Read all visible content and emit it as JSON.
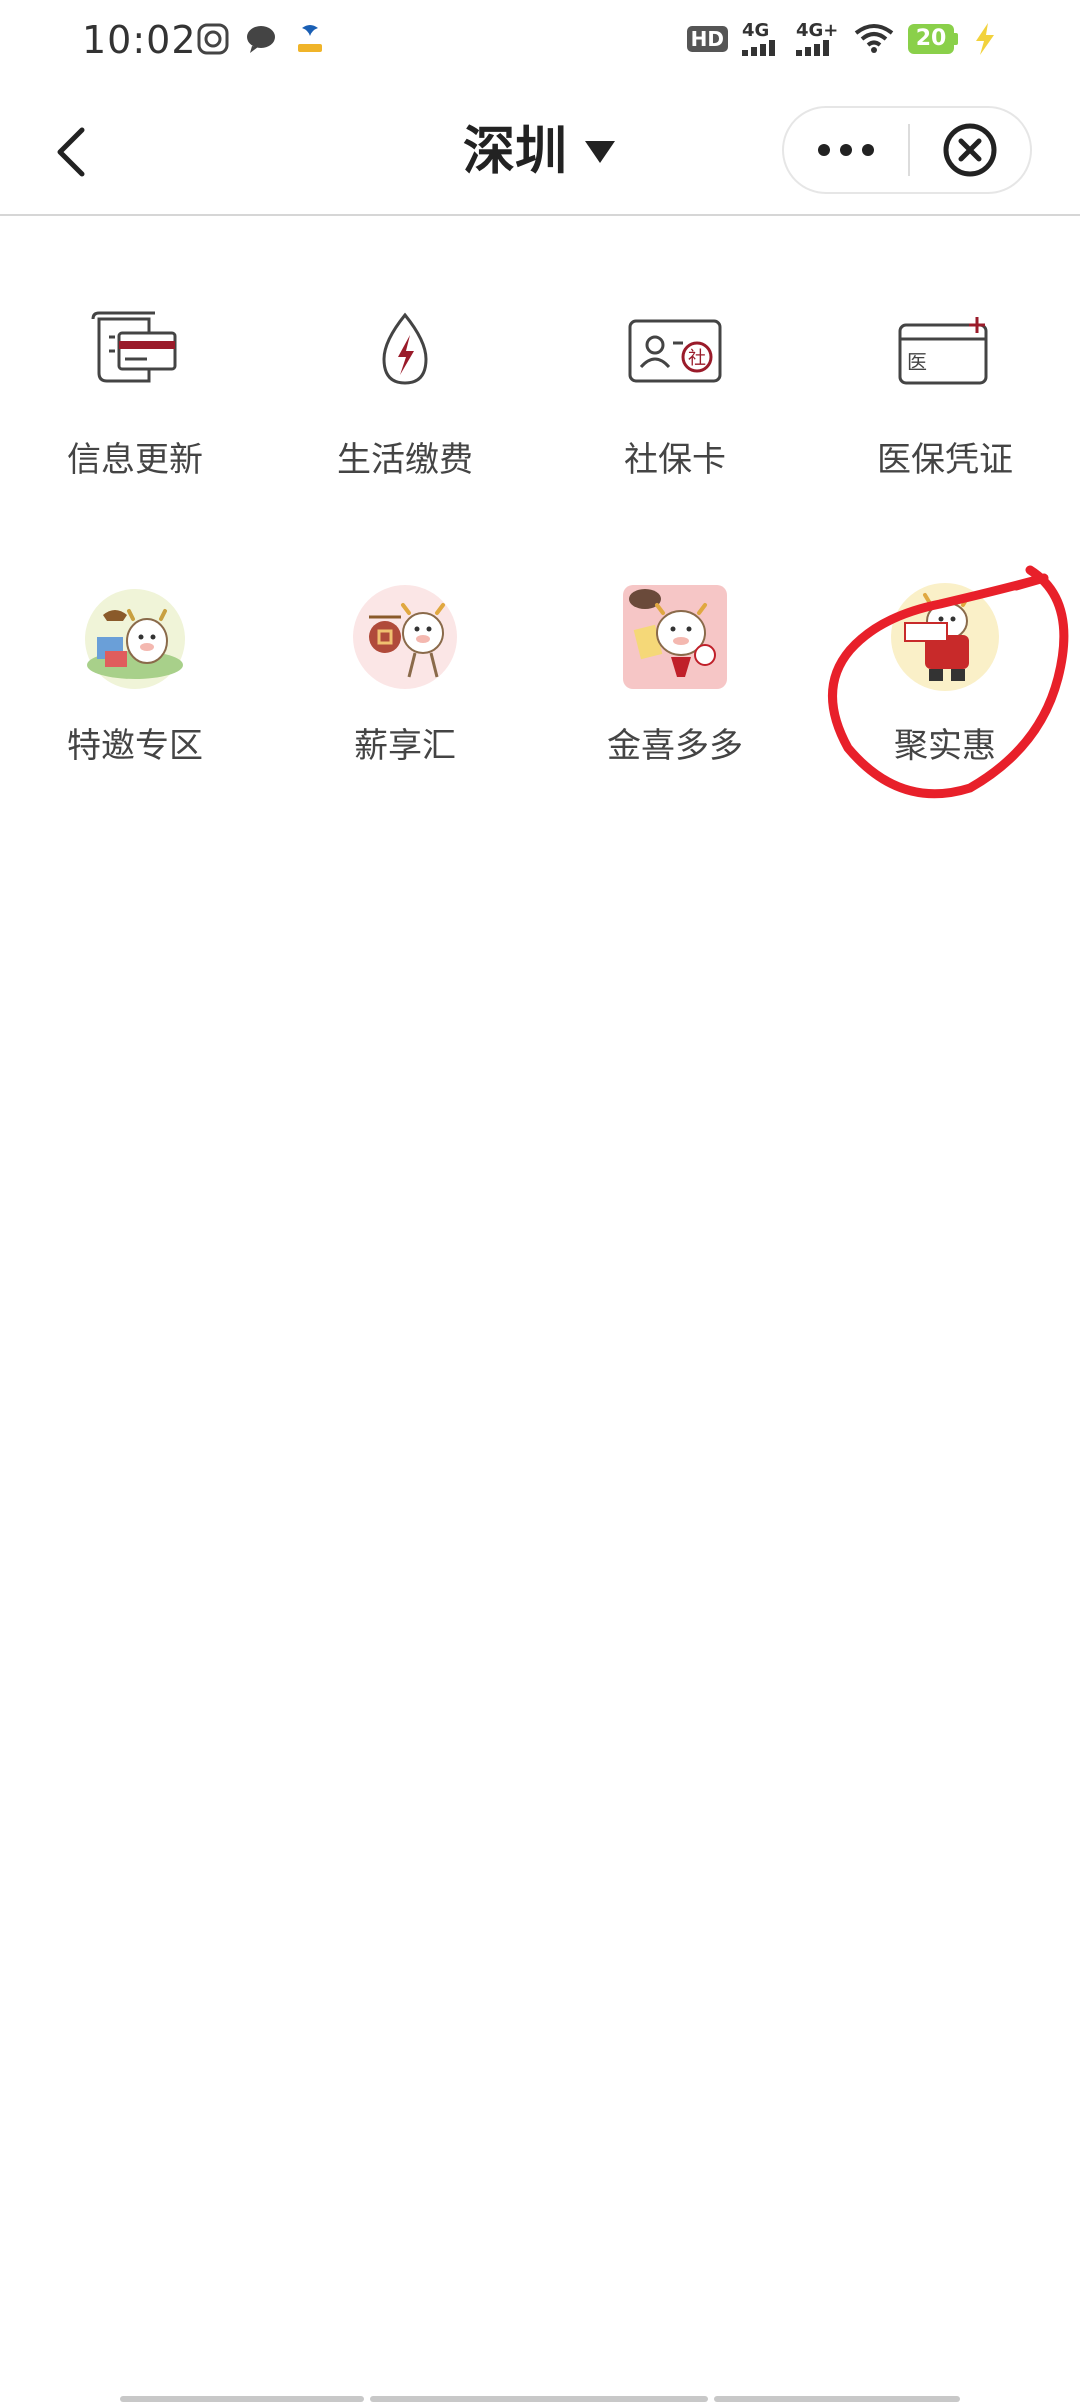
{
  "status_bar": {
    "time": "10:02",
    "hd_label": "HD",
    "signal_1": "4G",
    "signal_2": "4G+",
    "battery": "20"
  },
  "nav": {
    "title": "深圳",
    "more_icon": "more-dots-icon",
    "close_icon": "close-circle-icon",
    "back_icon": "chevron-left-icon",
    "dropdown_icon": "triangle-down-icon"
  },
  "grid": {
    "items": [
      {
        "label": "信息更新",
        "icon": "info-update-icon"
      },
      {
        "label": "生活缴费",
        "icon": "utility-payment-icon"
      },
      {
        "label": "社保卡",
        "icon": "social-security-card-icon"
      },
      {
        "label": "医保凭证",
        "icon": "medical-insurance-card-icon"
      },
      {
        "label": "特邀专区",
        "icon": "special-invite-icon"
      },
      {
        "label": "薪享汇",
        "icon": "salary-benefit-icon"
      },
      {
        "label": "金喜多多",
        "icon": "golden-joy-icon"
      },
      {
        "label": "聚实惠",
        "icon": "good-deals-icon"
      }
    ]
  },
  "colors": {
    "accent_red": "#9a1b2a",
    "annotation_red": "#e8202a",
    "battery_green": "#8ad04a"
  }
}
